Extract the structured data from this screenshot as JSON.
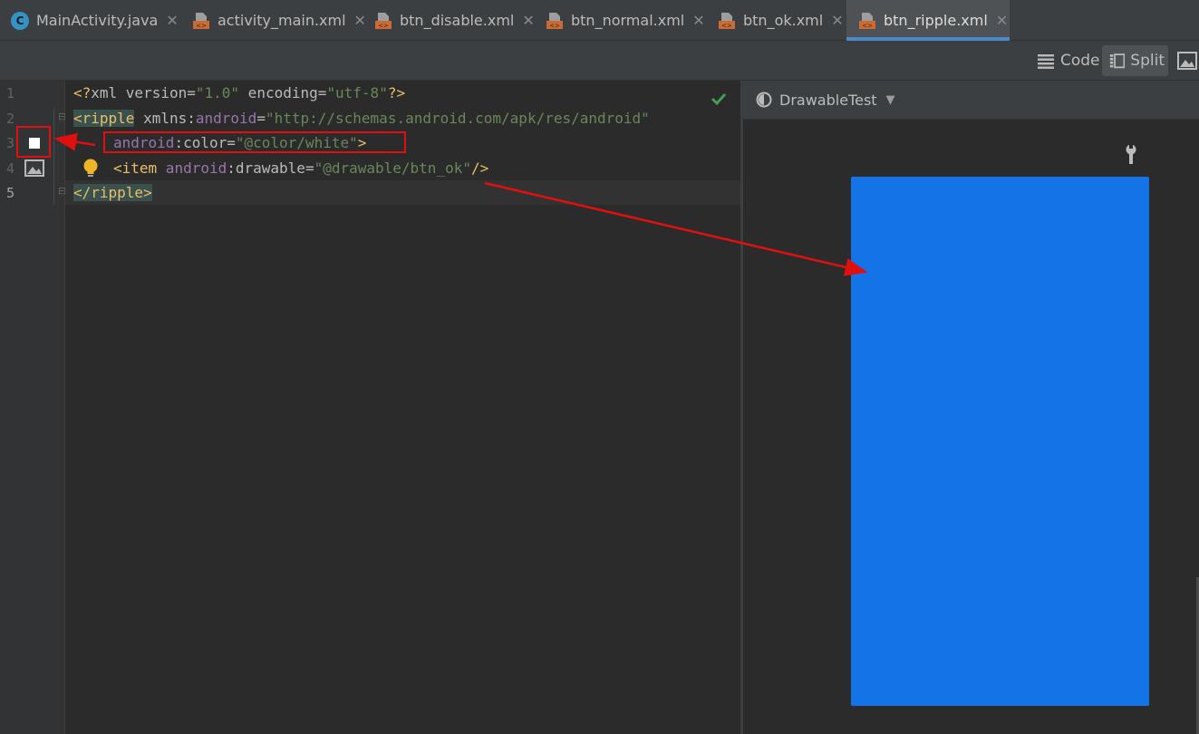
{
  "tabs": [
    {
      "label": "MainActivity.java",
      "icon": "java-class-icon",
      "active": false
    },
    {
      "label": "activity_main.xml",
      "icon": "xml-file-icon",
      "active": false
    },
    {
      "label": "btn_disable.xml",
      "icon": "xml-file-icon",
      "active": false
    },
    {
      "label": "btn_normal.xml",
      "icon": "xml-file-icon",
      "active": false
    },
    {
      "label": "btn_ok.xml",
      "icon": "xml-file-icon",
      "active": false
    },
    {
      "label": "btn_ripple.xml",
      "icon": "xml-file-icon",
      "active": true
    }
  ],
  "tab_close_glyph": "✕",
  "class_icon_letter": "C",
  "toolbar": {
    "code_label": "Code",
    "split_label": "Split",
    "active_mode": "Split"
  },
  "editor": {
    "line_numbers": [
      "1",
      "2",
      "3",
      "4",
      "5"
    ],
    "lines": {
      "l1": {
        "a": "<?",
        "b": "xml ",
        "c": "version",
        "d": "=",
        "e": "\"1.0\"",
        "f": " encoding",
        "g": "=",
        "h": "\"utf-8\"",
        "i": "?>"
      },
      "l2": {
        "a": "<ripple",
        "b": " xmlns",
        "c": ":",
        "d": "android",
        "e": "=",
        "f": "\"http://schemas.android.com/apk/res/android\""
      },
      "l3": {
        "a": "android",
        "b": ":color",
        "c": "=",
        "d": "\"@color/white\"",
        "e": ">"
      },
      "l4": {
        "a": "<item",
        "b": " android",
        "c": ":drawable",
        "d": "=",
        "e": "\"@drawable/btn_ok\"",
        "f": "/>"
      },
      "l5": {
        "a": "</ripple>"
      }
    },
    "status": "no-problems-check-icon"
  },
  "preview": {
    "theme_label": "DrawableTest",
    "rect_color": "#1473e6"
  },
  "colors": {
    "annotation": "#e01010",
    "accent": "#4a88c7"
  }
}
